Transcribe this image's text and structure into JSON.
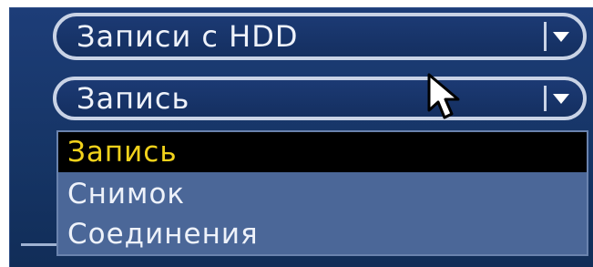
{
  "combo_hdd": {
    "value": "Записи с HDD",
    "icon": "chevron-down-icon"
  },
  "combo_type": {
    "value": "Запись",
    "icon": "chevron-down-icon"
  },
  "dropdown": {
    "options": [
      {
        "label": "Запись",
        "selected": true
      },
      {
        "label": "Снимок",
        "selected": false
      },
      {
        "label": "Соединения",
        "selected": false
      }
    ],
    "highlight_color": "#f1d21b"
  },
  "colors": {
    "panel": "#1d3d78",
    "dropdown": "#4b6798",
    "selected_bg": "#000000"
  },
  "cursor": {
    "icon": "mouse-pointer-icon"
  }
}
